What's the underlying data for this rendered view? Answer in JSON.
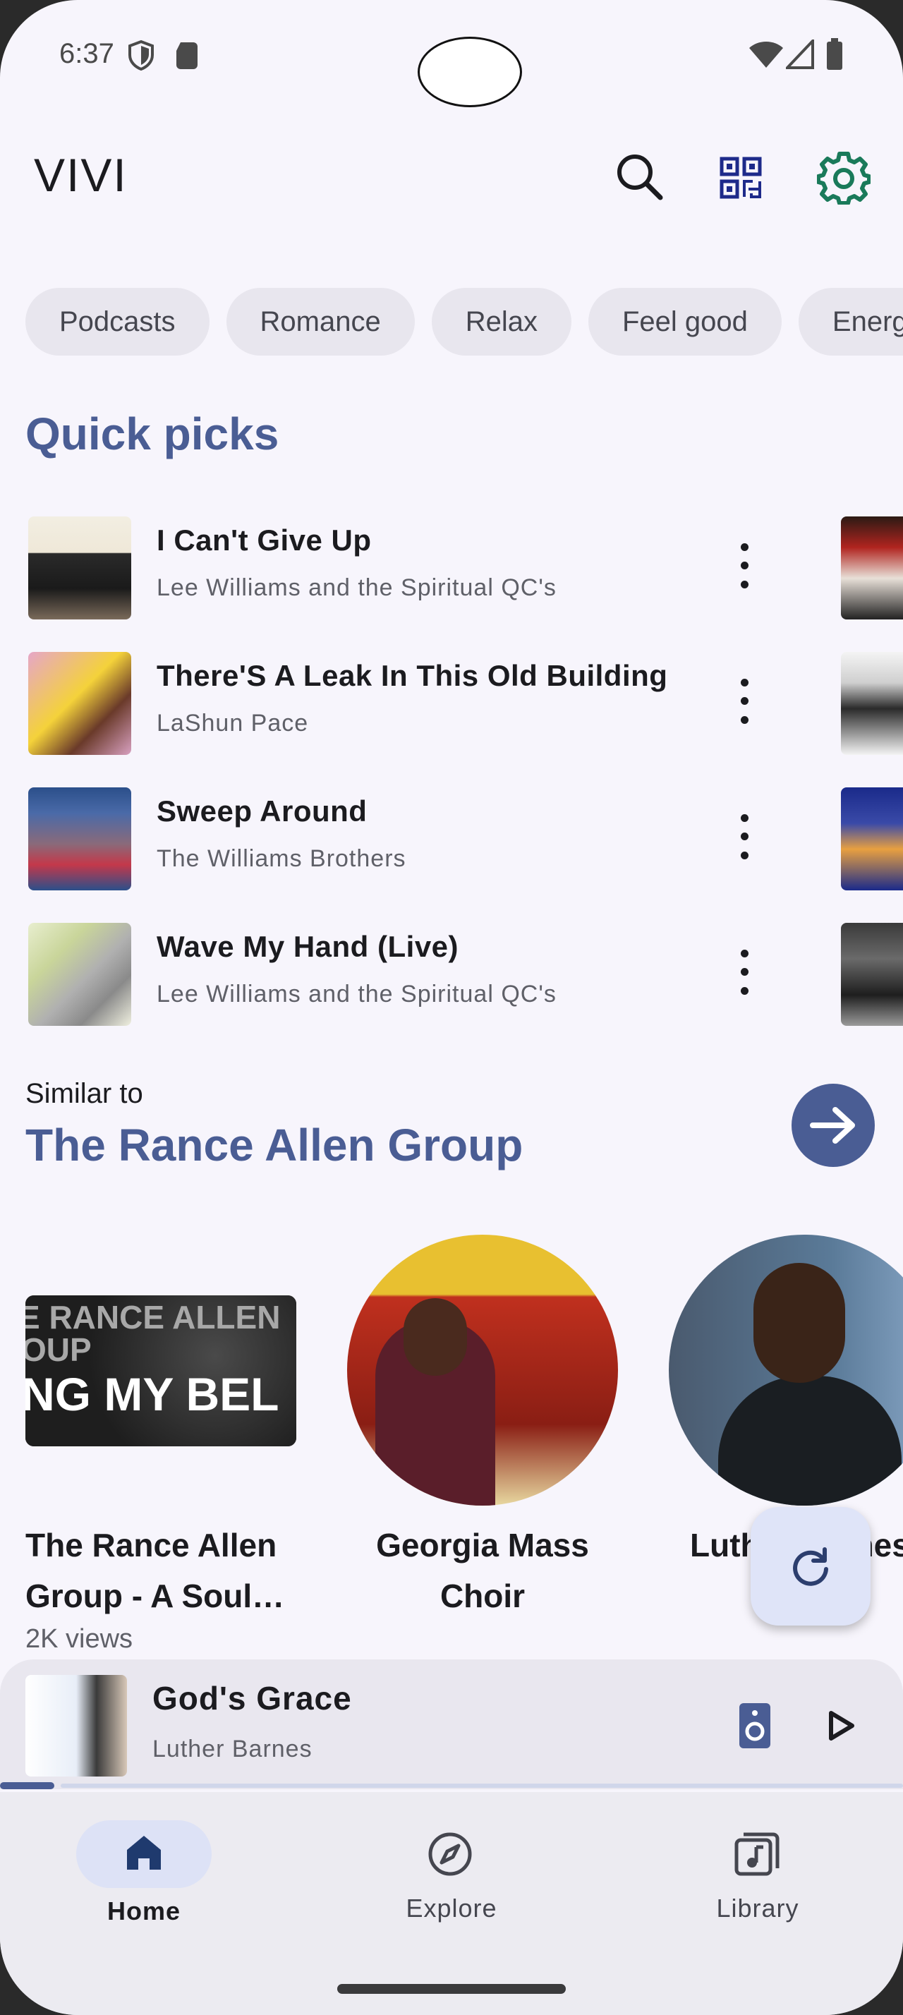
{
  "status_bar": {
    "time": "6:37"
  },
  "app": {
    "title": "VIVI"
  },
  "chips": [
    "Podcasts",
    "Romance",
    "Relax",
    "Feel good",
    "Energize"
  ],
  "quick_picks": {
    "title": "Quick picks",
    "items": [
      {
        "title": "I Can't Give Up",
        "artist": "Lee Williams and the Spiritual QC's"
      },
      {
        "title": "There'S A Leak In This Old Building",
        "artist": "LaShun Pace"
      },
      {
        "title": "Sweep Around",
        "artist": "The Williams Brothers"
      },
      {
        "title": "Wave My Hand (Live)",
        "artist": "Lee Williams and the Spiritual QC's"
      }
    ]
  },
  "similar": {
    "prefix": "Similar to",
    "title": "The Rance Allen Group",
    "thumb_text_1": "E RANCE ALLEN",
    "thumb_text_2": "OUP",
    "thumb_text_3": "NG MY BEL",
    "cards": [
      {
        "title_line1": "The Rance Allen",
        "title_line2": "Group - A Soul…",
        "subtitle": "2K views"
      },
      {
        "title_line1": "Georgia Mass",
        "title_line2": "Choir"
      },
      {
        "title_line1": "Luther Barnes"
      }
    ]
  },
  "now_playing": {
    "title": "God's Grace",
    "artist": "Luther Barnes",
    "progress": 0.06
  },
  "nav": {
    "home": "Home",
    "explore": "Explore",
    "library": "Library"
  },
  "colors": {
    "accent": "#4a5d94",
    "gear": "#1a7a5a",
    "qr": "#1e2a8a"
  }
}
